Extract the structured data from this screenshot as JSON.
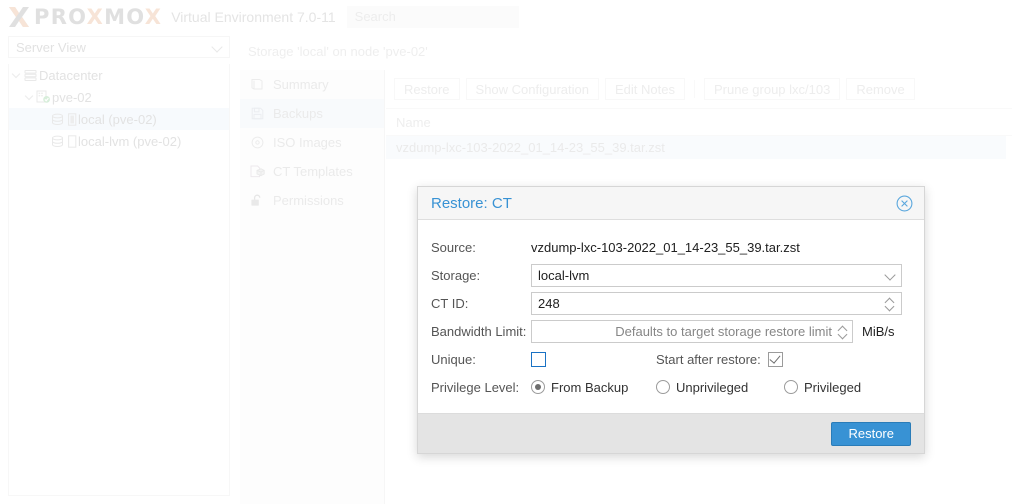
{
  "header": {
    "brand_pro": "PRO",
    "brand_x1": "X",
    "brand_mo": "MO",
    "brand_x2": "X",
    "product": "Virtual Environment 7.0-11",
    "search_placeholder": "Search",
    "brand_gray": "#9c9c9c",
    "brand_orange": "#e8a87c"
  },
  "sidebar": {
    "view_label": "Server View",
    "tree": [
      {
        "label": "Datacenter",
        "indent": 0,
        "icon": "datacenter-icon",
        "selected": false
      },
      {
        "label": "pve-02",
        "indent": 1,
        "icon": "node-icon",
        "selected": false
      },
      {
        "label": "local (pve-02)",
        "indent": 2,
        "icon": "storage-icon",
        "selected": true
      },
      {
        "label": "local-lvm (pve-02)",
        "indent": 2,
        "icon": "storage-icon",
        "selected": false
      }
    ]
  },
  "breadcrumb": "Storage 'local' on node 'pve-02'",
  "nav": {
    "items": [
      {
        "label": "Summary",
        "icon": "book-icon",
        "active": false
      },
      {
        "label": "Backups",
        "icon": "floppy-disk-icon",
        "active": true
      },
      {
        "label": "ISO Images",
        "icon": "disc-icon",
        "active": false
      },
      {
        "label": "CT Templates",
        "icon": "template-icon",
        "active": false
      },
      {
        "label": "Permissions",
        "icon": "unlock-icon",
        "active": false
      }
    ]
  },
  "toolbar": {
    "restore": "Restore",
    "show_configuration": "Show Configuration",
    "edit_notes": "Edit Notes",
    "prune_group": "Prune group lxc/103",
    "remove": "Remove"
  },
  "grid": {
    "column_name": "Name",
    "rows": [
      {
        "name": "vzdump-lxc-103-2022_01_14-23_55_39.tar.zst",
        "selected": true
      }
    ]
  },
  "dialog": {
    "title": "Restore: CT",
    "accent_color": "#3892d4",
    "labels": {
      "source": "Source:",
      "storage": "Storage:",
      "ct_id": "CT ID:",
      "bandwidth_limit": "Bandwidth Limit:",
      "unique": "Unique:",
      "start_after_restore": "Start after restore:",
      "privilege_level": "Privilege Level:"
    },
    "values": {
      "source": "vzdump-lxc-103-2022_01_14-23_55_39.tar.zst",
      "storage": "local-lvm",
      "ct_id": "248",
      "bandwidth_placeholder": "Defaults to target storage restore limit",
      "bandwidth_unit": "MiB/s",
      "unique_checked": false,
      "start_after_restore_checked": true
    },
    "privilege_options": [
      {
        "label": "From Backup",
        "selected": true
      },
      {
        "label": "Unprivileged",
        "selected": false
      },
      {
        "label": "Privileged",
        "selected": false
      }
    ],
    "submit_label": "Restore"
  }
}
